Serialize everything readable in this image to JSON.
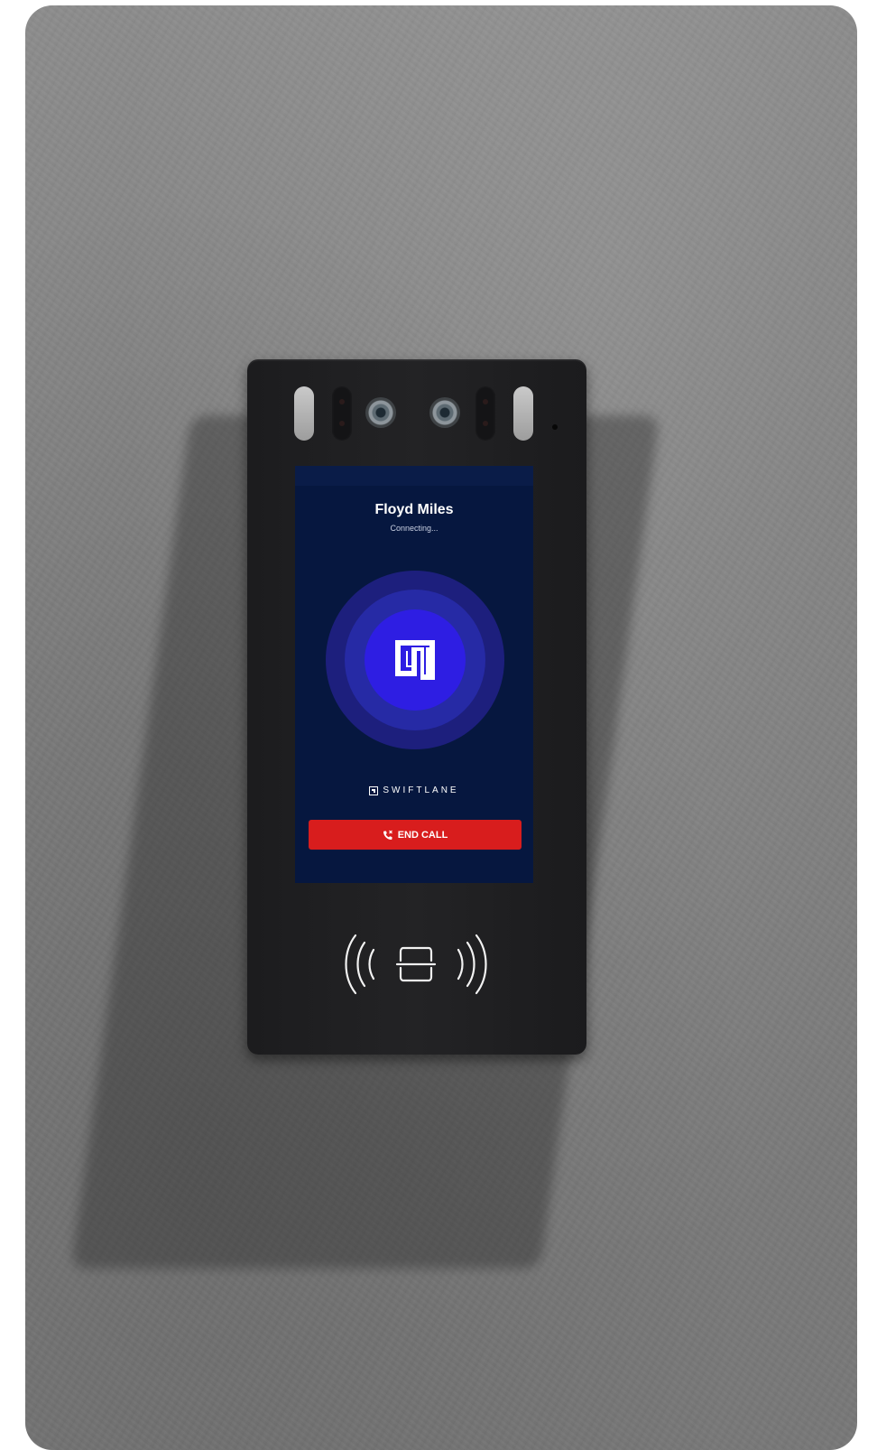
{
  "call_screen": {
    "caller_name": "Floyd Miles",
    "status": "Connecting...",
    "brand_name": "SWIFTLANE",
    "end_call_label": "END CALL"
  },
  "icons": {
    "logo": "swiftlane-logo-icon",
    "end_call": "phone-hangup-icon",
    "reader": "nfc-card-reader-icon"
  },
  "colors": {
    "screen_background": "#06173f",
    "logo_circle": "#2e1ee3",
    "end_call_button": "#d81d1d"
  }
}
